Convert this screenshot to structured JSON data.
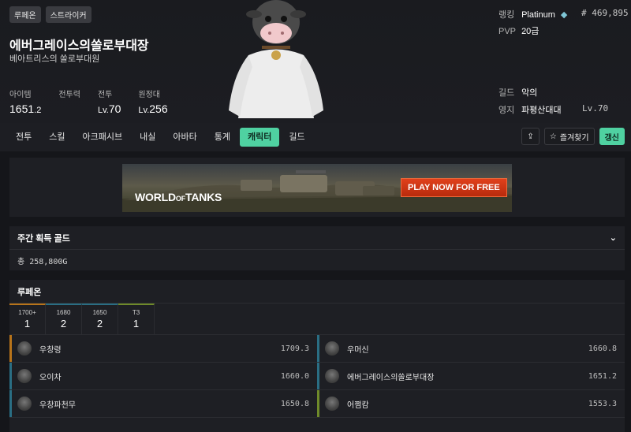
{
  "header": {
    "badges": [
      "루페온",
      "스트라이커"
    ],
    "name": "에버그레이스의쏠로부대장",
    "subtitle": "베아트리스의 쏠로부대원",
    "stats": [
      {
        "label": "아이템",
        "value": "1651",
        "decimal": ".2"
      },
      {
        "label": "전투력",
        "value": ""
      },
      {
        "label": "전투",
        "prefix": "Lv.",
        "value": "70"
      },
      {
        "label": "원정대",
        "prefix": "Lv.",
        "value": "256"
      }
    ],
    "ranking_label": "랭킹",
    "ranking_tier": "Platinum",
    "ranking_number": "# 469,895",
    "pvp_label": "PVP",
    "pvp_value": "20급",
    "guild_label": "길드",
    "guild_value": "악의",
    "estate_label": "영지",
    "estate_value": "파평산대대",
    "estate_level": "Lv.70"
  },
  "nav": {
    "tabs": [
      "전투",
      "스킬",
      "아크패시브",
      "내실",
      "아바타",
      "통계",
      "캐릭터",
      "길드"
    ],
    "active": "캐릭터",
    "bookmark_label": "즐겨찾기",
    "refresh_label": "갱신"
  },
  "ad": {
    "logo": "WORLD",
    "logo_mid": "OF",
    "logo_end": "TANKS",
    "cta": "PLAY NOW FOR FREE"
  },
  "weekly_gold": {
    "title": "주간 획득 골드",
    "total": "총 258,800G"
  },
  "roster": {
    "server": "루페온",
    "filters": [
      {
        "label": "1700+",
        "count": "1",
        "color": "#b8741a"
      },
      {
        "label": "1680",
        "count": "2",
        "color": "#2a6e84"
      },
      {
        "label": "1650",
        "count": "2",
        "color": "#2a6e84"
      },
      {
        "label": "T3",
        "count": "1",
        "color": "#6f8a2a"
      }
    ],
    "characters": [
      {
        "name": "우창령",
        "ilvl": "1709.3",
        "color": "#b8741a"
      },
      {
        "name": "우머신",
        "ilvl": "1660.8",
        "color": "#2a6e84"
      },
      {
        "name": "오이차",
        "ilvl": "1660.0",
        "color": "#2a6e84"
      },
      {
        "name": "에버그레이스의쏠로부대장",
        "ilvl": "1651.2",
        "color": "#2a6e84"
      },
      {
        "name": "우창파천무",
        "ilvl": "1650.8",
        "color": "#2a6e84"
      },
      {
        "name": "어쩜캄",
        "ilvl": "1553.3",
        "color": "#6f8a2a"
      }
    ]
  },
  "colors": {
    "accent": "#4fd1a1",
    "bg": "#15161a",
    "panel": "#1e1f24"
  }
}
